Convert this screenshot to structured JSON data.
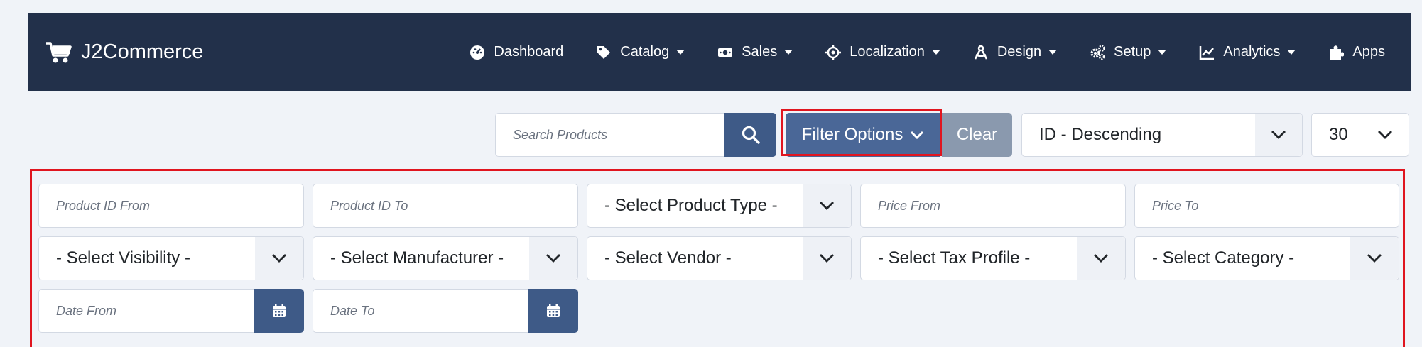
{
  "brand": {
    "name": "J2Commerce"
  },
  "nav": [
    {
      "label": "Dashboard",
      "icon": "dashboard-icon",
      "dropdown": false
    },
    {
      "label": "Catalog",
      "icon": "tag-icon",
      "dropdown": true
    },
    {
      "label": "Sales",
      "icon": "money-icon",
      "dropdown": true
    },
    {
      "label": "Localization",
      "icon": "crosshairs-icon",
      "dropdown": true
    },
    {
      "label": "Design",
      "icon": "compass-drafting-icon",
      "dropdown": true
    },
    {
      "label": "Setup",
      "icon": "gears-icon",
      "dropdown": true
    },
    {
      "label": "Analytics",
      "icon": "chart-line-icon",
      "dropdown": true
    },
    {
      "label": "Apps",
      "icon": "puzzle-icon",
      "dropdown": false
    }
  ],
  "toolbar": {
    "search_placeholder": "Search Products",
    "filter_label": "Filter Options",
    "clear_label": "Clear",
    "sort_value": "ID - Descending",
    "limit_value": "30"
  },
  "filters": {
    "product_id_from": "Product ID From",
    "product_id_to": "Product ID To",
    "product_type": "- Select Product Type -",
    "price_from": "Price From",
    "price_to": "Price To",
    "visibility": "- Select Visibility -",
    "manufacturer": "- Select Manufacturer -",
    "vendor": "- Select Vendor -",
    "tax_profile": "- Select Tax Profile -",
    "category": "- Select Category -",
    "date_from": "Date From",
    "date_to": "Date To"
  },
  "colors": {
    "navbar": "#22304a",
    "primary": "#3e5a87",
    "highlight": "#e0151f",
    "clear": "#8a99ae"
  }
}
